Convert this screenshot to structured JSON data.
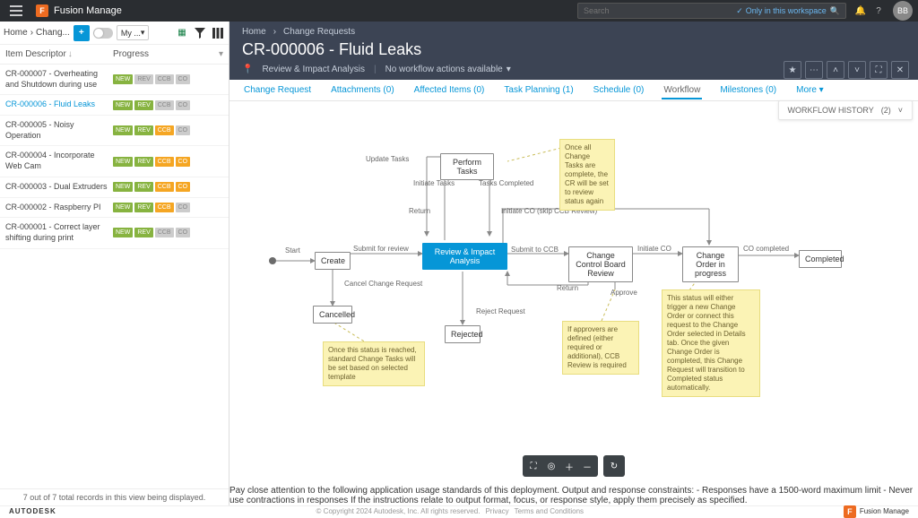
{
  "topbar": {
    "brand": "Fusion Manage",
    "brand_initial": "F",
    "search_placeholder": "Search",
    "scope": "Only in this workspace",
    "avatar": "BB"
  },
  "left": {
    "crumb_home": "Home",
    "crumb_current": "Chang...",
    "view": "My ...",
    "header_desc": "Item Descriptor",
    "header_prog": "Progress",
    "rows": [
      {
        "desc": "CR-000007 - Overheating and Shutdown during use",
        "tags": [
          "NEW",
          "REV",
          "CCB",
          "CO"
        ],
        "style": [
          0,
          2,
          2,
          2
        ]
      },
      {
        "desc": "CR-000006 - Fluid Leaks",
        "tags": [
          "NEW",
          "REV",
          "CCB",
          "CO"
        ],
        "style": [
          0,
          0,
          2,
          2
        ],
        "active": true
      },
      {
        "desc": "CR-000005 - Noisy Operation",
        "tags": [
          "NEW",
          "REV",
          "CCB",
          "CO"
        ],
        "style": [
          0,
          0,
          1,
          2
        ]
      },
      {
        "desc": "CR-000004 - Incorporate Web Cam",
        "tags": [
          "NEW",
          "REV",
          "CCB",
          "CO"
        ],
        "style": [
          0,
          0,
          1,
          1
        ]
      },
      {
        "desc": "CR-000003 - Dual Extruders",
        "tags": [
          "NEW",
          "REV",
          "CCB",
          "CO"
        ],
        "style": [
          0,
          0,
          1,
          1
        ]
      },
      {
        "desc": "CR-000002 - Raspberry PI",
        "tags": [
          "NEW",
          "REV",
          "CCB",
          "CO"
        ],
        "style": [
          0,
          0,
          1,
          2
        ]
      },
      {
        "desc": "CR-000001 - Correct layer shifting during print",
        "tags": [
          "NEW",
          "REV",
          "CCB",
          "CO"
        ],
        "style": [
          0,
          0,
          2,
          2
        ]
      }
    ],
    "footer_text": "7 out of 7 total records in this view being displayed."
  },
  "right": {
    "crumbs": [
      "Home",
      "Change Requests"
    ],
    "title": "CR-000006 - Fluid Leaks",
    "status": "Review & Impact Analysis",
    "action_dd": "No workflow actions available",
    "tabs": [
      {
        "label": "Change Request"
      },
      {
        "label": "Attachments (0)"
      },
      {
        "label": "Affected Items (0)"
      },
      {
        "label": "Task Planning (1)"
      },
      {
        "label": "Schedule (0)"
      },
      {
        "label": "Workflow",
        "active": true,
        "plain": true
      },
      {
        "label": "Milestones (0)"
      },
      {
        "label": "More"
      }
    ],
    "wfh_label": "WORKFLOW HISTORY",
    "wfh_count": "(2)"
  },
  "wf": {
    "start": "Start",
    "nodes": {
      "create": "Create",
      "ria": "Review & Impact Analysis",
      "ccbr": "Change Control Board Review",
      "coip": "Change Order in progress",
      "completed": "Completed",
      "cancelled": "Cancelled",
      "rejected": "Rejected",
      "perform": "Perform Tasks"
    },
    "edges": {
      "submit": "Submit for review",
      "cancel": "Cancel Change Request",
      "submitccb": "Submit to CCB",
      "reject": "Reject Request",
      "return": "Return",
      "return2": "Return",
      "approve": "Approve",
      "initiateco": "Initiate CO",
      "skip": "Initiate CO (skip CCB Review)",
      "cocomplete": "CO completed",
      "update": "Update Tasks",
      "initiate": "Initiate Tasks",
      "tcompl": "Tasks Completed"
    },
    "notes": {
      "n1": "Once this status is reached, standard Change Tasks will be set based on selected template",
      "n2": "Once all Change Tasks are complete, the CR will be set to review status again",
      "n3": "If approvers are defined (either required or additional), CCB Review is required",
      "n4": "This status will either trigger a new Change Order or connect this request to the Change Order selected in Details tab. Once the given Change Order is completed, this Change Request will transition to Completed status automatically."
    }
  },
  "footer": {
    "autodesk": "AUTODESK",
    "copy": "© Copyright 2024 Autodesk, Inc. All rights reserved.",
    "priv": "Privacy",
    "terms": "Terms and Conditions",
    "brand": "Fusion Manage",
    "brand_initial": "F"
  }
}
